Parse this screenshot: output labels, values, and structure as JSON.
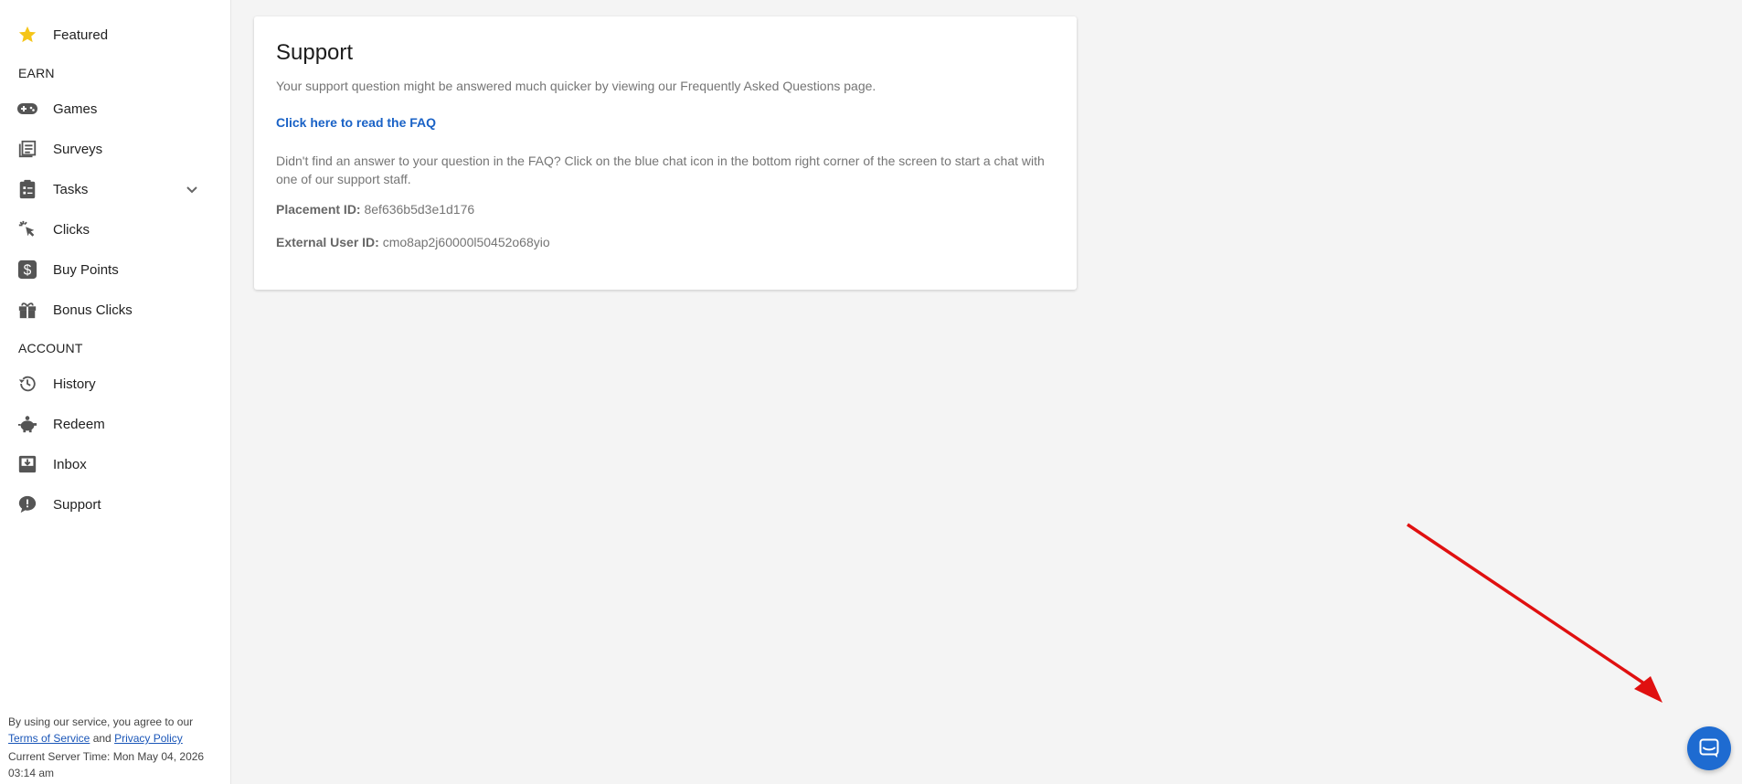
{
  "sidebar": {
    "items": [
      {
        "label": "Featured",
        "icon": "star-icon"
      },
      {
        "label": "Games",
        "icon": "gamepad-icon"
      },
      {
        "label": "Surveys",
        "icon": "surveys-icon"
      },
      {
        "label": "Tasks",
        "icon": "clipboard-icon"
      },
      {
        "label": "Clicks",
        "icon": "cursor-click-icon"
      },
      {
        "label": "Buy Points",
        "icon": "dollar-icon"
      },
      {
        "label": "Bonus Clicks",
        "icon": "gift-icon"
      },
      {
        "label": "History",
        "icon": "history-icon"
      },
      {
        "label": "Redeem",
        "icon": "piggy-bank-icon"
      },
      {
        "label": "Inbox",
        "icon": "inbox-icon"
      },
      {
        "label": "Support",
        "icon": "feedback-icon"
      }
    ],
    "sections": {
      "earn": "EARN",
      "account": "ACCOUNT"
    }
  },
  "footer": {
    "agree_text": "By using our service, you agree to our",
    "terms_link": "Terms of Service",
    "and_text": "and",
    "privacy_link": "Privacy Policy",
    "server_time_label": "Current Server Time: Mon May 04, 2026",
    "server_time_clock": "03:14 am"
  },
  "main": {
    "title": "Support",
    "intro": "Your support question might be answered much quicker by viewing our Frequently Asked Questions page.",
    "faq_link": "Click here to read the FAQ",
    "help_text": "Didn't find an answer to your question in the FAQ? Click on the blue chat icon in the bottom right corner of the screen to start a chat with one of our support staff.",
    "placement_label": "Placement ID:",
    "placement_value": "8ef636b5d3e1d176",
    "external_label": "External User ID:",
    "external_value": "cmo8ap2j60000l50452o68yio"
  },
  "colors": {
    "accent": "#1e6bd1",
    "link": "#1a62c6",
    "star": "#f5c518",
    "arrow": "#e01010",
    "icon_gray": "#555555"
  },
  "overlay": {
    "arrow_icon": "red-arrow-annotation",
    "chat_icon": "chat-bubble-icon"
  }
}
